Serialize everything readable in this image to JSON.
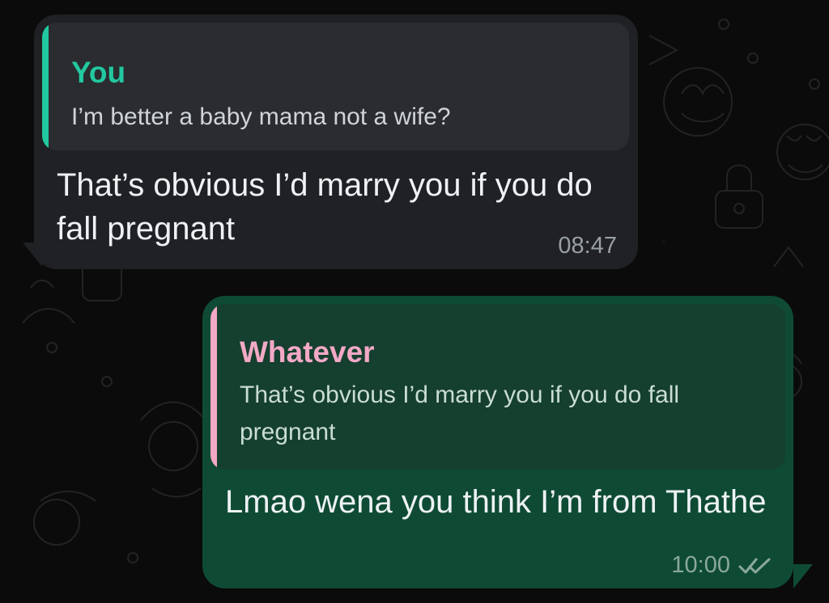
{
  "chat": {
    "incoming": {
      "reply_author": "You",
      "reply_text": "I’m better a baby mama not a wife?",
      "message_text": "That’s obvious I’d marry you if you do fall pregnant",
      "time": "08:47"
    },
    "outgoing": {
      "reply_author": "Whatever",
      "reply_text": "That’s obvious I’d marry you if you do fall pregnant",
      "message_text": "Lmao wena you think I’m from Thathe",
      "time": "10:00"
    }
  },
  "colors": {
    "incoming_bubble": "#1f2124",
    "outgoing_bubble": "#0f4b34",
    "incoming_quote_accent": "#22c89f",
    "outgoing_quote_accent": "#f3a9c6"
  },
  "icons": {
    "read_receipt": "double-check-icon"
  }
}
